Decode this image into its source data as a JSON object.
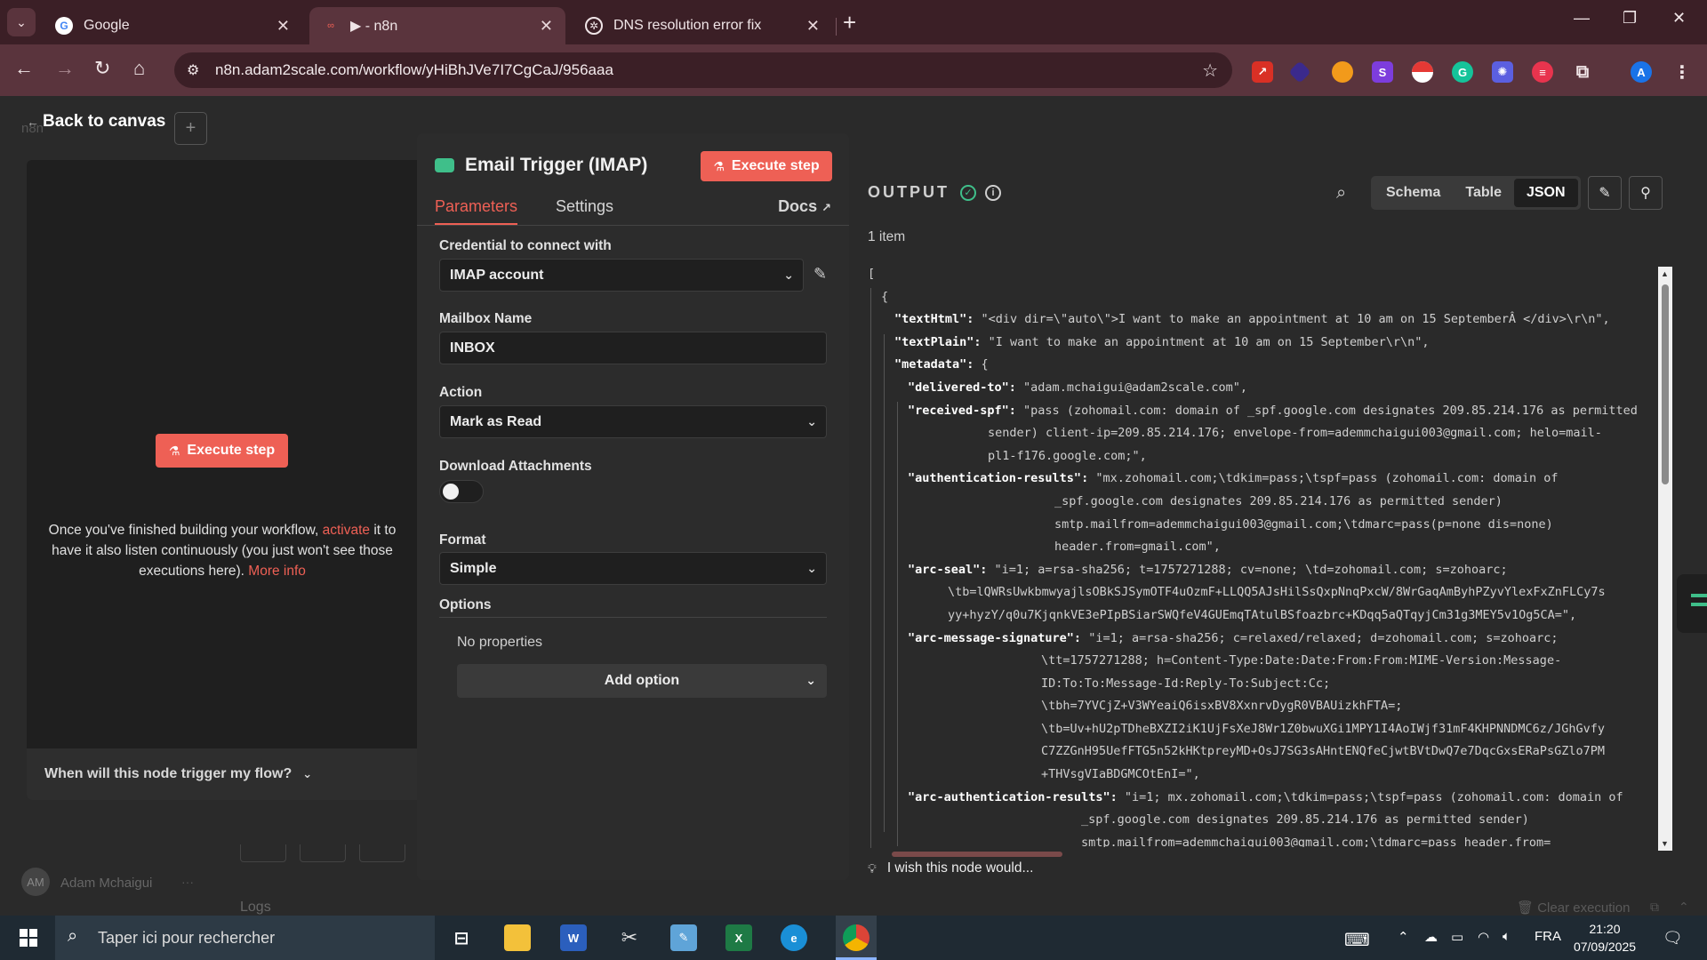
{
  "browser": {
    "tabs": [
      {
        "title": "Google",
        "icon": "google-icon",
        "active": false
      },
      {
        "title": "▶ - n8n",
        "icon": "n8n-icon",
        "active": true
      },
      {
        "title": "DNS resolution error fix",
        "icon": "chatgpt-icon",
        "active": false
      }
    ],
    "url": "n8n.adam2scale.com/workflow/yHiBhJVe7I7CgCaJ/956aaa",
    "tab_close": "✕",
    "new_tab": "+",
    "window_controls": {
      "minimize": "—",
      "restore": "❐",
      "close": "✕"
    },
    "nav": {
      "back": "←",
      "forward": "→",
      "reload": "↻",
      "home": "⌂"
    },
    "star": "☆",
    "profile_initial": "A"
  },
  "app": {
    "back_to_canvas": "Back to canvas",
    "ghost_logo_text": "n8n",
    "plus": "+",
    "left": {
      "execute_label": "Execute step",
      "info_pre": "Once you've finished building your workflow, ",
      "info_link": "activate",
      "info_mid": " it to have it also listen continuously (you just won't see those executions here). ",
      "info_more": "More info",
      "trigger_question": "When will this node trigger my flow?"
    },
    "node": {
      "title": "Email Trigger (IMAP)",
      "execute_label": "Execute step",
      "tabs": {
        "parameters": "Parameters",
        "settings": "Settings",
        "docs": "Docs"
      },
      "fields": {
        "credential_label": "Credential to connect with",
        "credential_value": "IMAP account",
        "mailbox_label": "Mailbox Name",
        "mailbox_value": "INBOX",
        "action_label": "Action",
        "action_value": "Mark as Read",
        "download_label": "Download Attachments",
        "download_enabled": false,
        "format_label": "Format",
        "format_value": "Simple",
        "options_label": "Options",
        "no_properties": "No properties",
        "add_option": "Add option"
      }
    },
    "output": {
      "title": "OUTPUT",
      "items_count": "1 item",
      "views": {
        "schema": "Schema",
        "table": "Table",
        "json": "JSON"
      },
      "active_view": "JSON",
      "wish": "I wish this node would...",
      "json_lines": [
        {
          "indent": 0,
          "text": "["
        },
        {
          "indent": 1,
          "text": "{"
        },
        {
          "indent": 2,
          "key": "\"textHtml\":",
          "val": " \"<div dir=\\\"auto\\\">I want to make an appointment at 10 am on 15 SeptemberÂ </div>\\r\\n\","
        },
        {
          "indent": 2,
          "key": "\"textPlain\":",
          "val": " \"I want to make an appointment at 10 am on 15 September\\r\\n\","
        },
        {
          "indent": 2,
          "key": "\"metadata\":",
          "val": " {"
        },
        {
          "indent": 3,
          "key": "\"delivered-to\":",
          "val": " \"adam.mchaigui@adam2scale.com\","
        },
        {
          "indent": 3,
          "key": "\"received-spf\":",
          "val": " \"pass (zohomail.com: domain of _spf.google.com designates 209.85.214.176 as permitted"
        },
        {
          "indent": 9,
          "text": "sender) client-ip=209.85.214.176; envelope-from=ademmchaigui003@gmail.com; helo=mail-"
        },
        {
          "indent": 9,
          "text": "pl1-f176.google.com;\","
        },
        {
          "indent": 3,
          "key": "\"authentication-results\":",
          "val": " \"mx.zohomail.com;\\tdkim=pass;\\tspf=pass (zohomail.com: domain of"
        },
        {
          "indent": 14,
          "text": "_spf.google.com designates 209.85.214.176 as permitted sender)"
        },
        {
          "indent": 14,
          "text": "smtp.mailfrom=ademmchaigui003@gmail.com;\\tdmarc=pass(p=none dis=none)"
        },
        {
          "indent": 14,
          "text": "header.from=gmail.com\","
        },
        {
          "indent": 3,
          "key": "\"arc-seal\":",
          "val": " \"i=1; a=rsa-sha256; t=1757271288; cv=none; \\td=zohomail.com; s=zohoarc;"
        },
        {
          "indent": 6,
          "text": "\\tb=lQWRsUwkbmwyajlsOBkSJSymOTF4uOzmF+LLQQ5AJsHilSsQxpNnqPxcW/8WrGaqAmByhPZyvYlexFxZnFLCy7s"
        },
        {
          "indent": 6,
          "text": "yy+hyzY/q0u7KjqnkVE3ePIpBSiarSWQfeV4GUEmqTAtulBSfoazbrc+KDqq5aQTqyjCm31g3MEY5v1Og5CA=\","
        },
        {
          "indent": 3,
          "key": "\"arc-message-signature\":",
          "val": " \"i=1; a=rsa-sha256; c=relaxed/relaxed; d=zohomail.com; s=zohoarc;"
        },
        {
          "indent": 13,
          "text": "\\tt=1757271288; h=Content-Type:Date:Date:From:From:MIME-Version:Message-"
        },
        {
          "indent": 13,
          "text": "ID:To:To:Message-Id:Reply-To:Subject:Cc;"
        },
        {
          "indent": 13,
          "text": "\\tbh=7YVCjZ+V3WYeaiQ6isxBV8XxnrvDygR0VBAUizkhFTA=;"
        },
        {
          "indent": 13,
          "text": "\\tb=Uv+hU2pTDheBXZI2iK1UjFsXeJ8Wr1Z0bwuXGi1MPY1I4AoIWjf31mF4KHPNNDMC6z/JGhGvfy"
        },
        {
          "indent": 13,
          "text": "C7ZZGnH95UefFTG5n52kHKtpreyMD+OsJ7SG3sAHntENQfeCjwtBVtDwQ7e7DqcGxsERaPsGZlo7PM"
        },
        {
          "indent": 13,
          "text": "+THVsgVIaBDGMCOtEnI=\","
        },
        {
          "indent": 3,
          "key": "\"arc-authentication-results\":",
          "val": " \"i=1; mx.zohomail.com;\\tdkim=pass;\\tspf=pass (zohomail.com: domain of"
        },
        {
          "indent": 16,
          "text": "_spf.google.com designates 209.85.214.176 as permitted sender)"
        },
        {
          "indent": 16,
          "text": "smtp.mailfrom=ademmchaigui003@gmail.com;\\tdmarc=pass header.from="
        }
      ]
    },
    "footer": {
      "user_initials": "AM",
      "user_name": "Adam Mchaigui",
      "user_menu": "···",
      "logs": "Logs",
      "clear_execution": "Clear execution"
    }
  },
  "taskbar": {
    "search_placeholder": "Taper ici pour rechercher",
    "lang": "FRA",
    "time": "21:20",
    "date": "07/09/2025"
  },
  "colors": {
    "accent": "#ee6055",
    "success": "#3fbf8a",
    "chrome_dark": "#3b1f26",
    "chrome_mid": "#5a343d"
  }
}
